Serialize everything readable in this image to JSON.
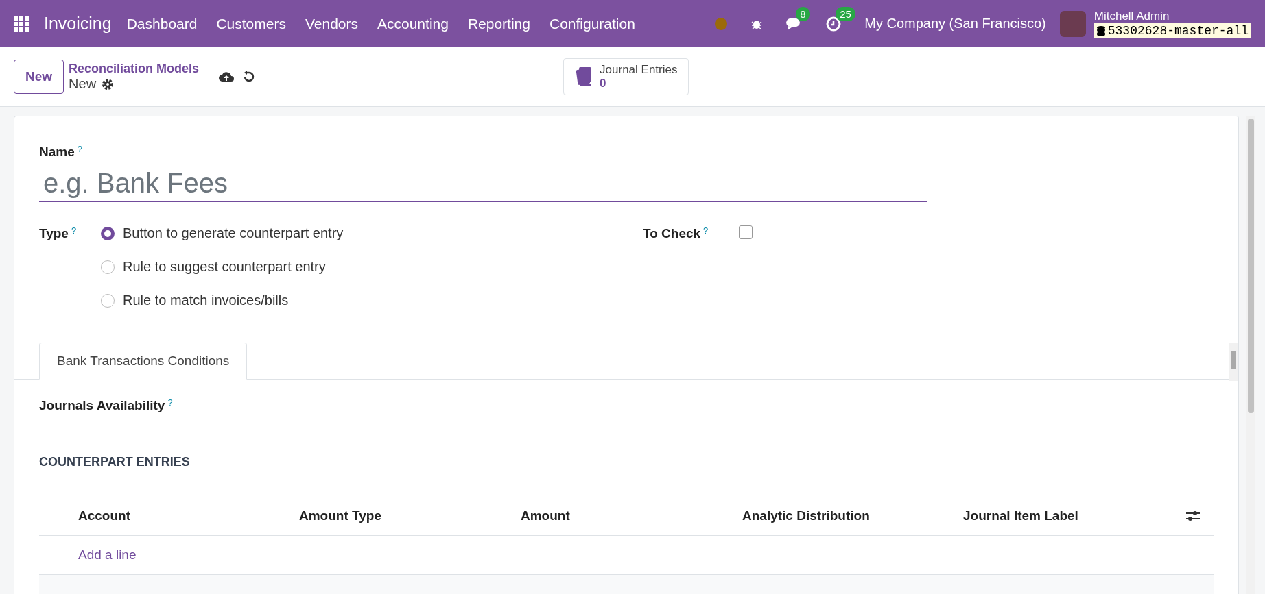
{
  "navbar": {
    "app_name": "Invoicing",
    "menu": [
      "Dashboard",
      "Customers",
      "Vendors",
      "Accounting",
      "Reporting",
      "Configuration"
    ],
    "chat_count": "8",
    "activity_count": "25",
    "company": "My Company (San Francisco)",
    "user": "Mitchell Admin",
    "database": "53302628-master-all"
  },
  "control_panel": {
    "new_button": "New",
    "breadcrumb": "Reconciliation Models",
    "record": "New",
    "smart_button": {
      "label": "Journal Entries",
      "value": "0"
    }
  },
  "form": {
    "name": {
      "label": "Name",
      "help": "?",
      "placeholder": "e.g. Bank Fees"
    },
    "type": {
      "label": "Type",
      "help": "?",
      "options": [
        {
          "label": "Button to generate counterpart entry",
          "selected": true
        },
        {
          "label": "Rule to suggest counterpart entry",
          "selected": false
        },
        {
          "label": "Rule to match invoices/bills",
          "selected": false
        }
      ]
    },
    "to_check": {
      "label": "To Check",
      "help": "?",
      "checked": false
    },
    "tabs": [
      {
        "label": "Bank Transactions Conditions",
        "selected": true
      }
    ],
    "journals_availability": {
      "label": "Journals Availability",
      "help": "?"
    },
    "counterpart": {
      "title": "COUNTERPART ENTRIES",
      "columns": [
        "Account",
        "Amount Type",
        "Amount",
        "Analytic Distribution",
        "Journal Item Label"
      ],
      "add_line": "Add a line"
    }
  }
}
